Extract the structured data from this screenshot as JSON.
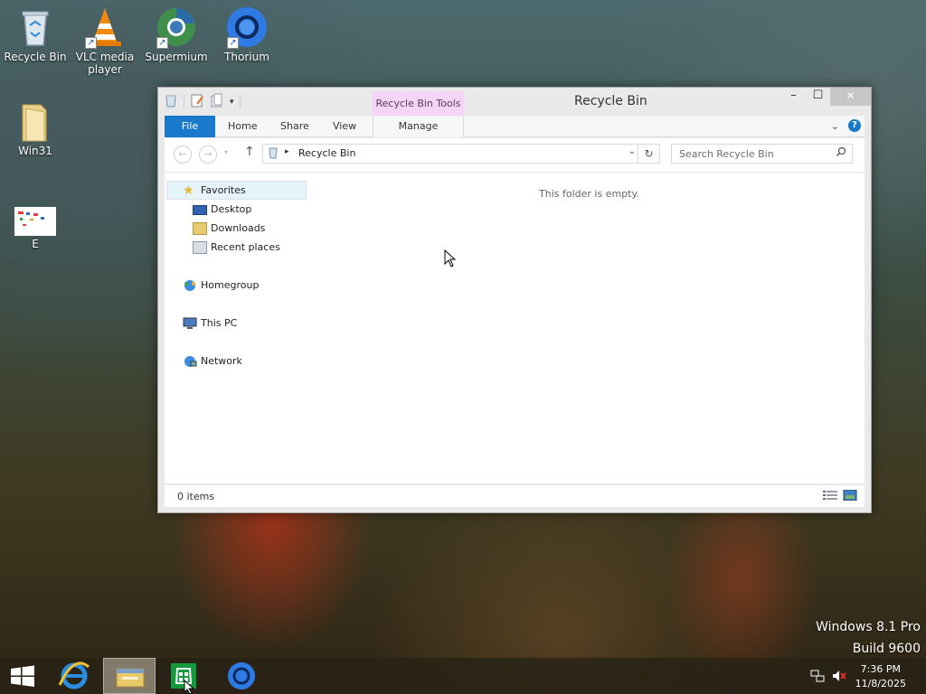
{
  "desktop": {
    "icons": [
      {
        "label": "Recycle Bin",
        "icon": "recycle-bin-icon"
      },
      {
        "label": "VLC media player",
        "icon": "vlc-icon"
      },
      {
        "label": "Supermium",
        "icon": "supermium-icon"
      },
      {
        "label": "Thorium",
        "icon": "thorium-icon"
      },
      {
        "label": "Win31",
        "icon": "folder-icon"
      },
      {
        "label": "E",
        "icon": "image-file-icon"
      }
    ]
  },
  "window": {
    "title": "Recycle Bin",
    "context_tab": "Recycle Bin Tools",
    "tabs": {
      "file": "File",
      "home": "Home",
      "share": "Share",
      "view": "View",
      "manage": "Manage"
    },
    "address": {
      "crumb": "Recycle Bin"
    },
    "search": {
      "placeholder": "Search Recycle Bin"
    },
    "nav_pane": {
      "favorites": "Favorites",
      "desktop": "Desktop",
      "downloads": "Downloads",
      "recent_places": "Recent places",
      "homegroup": "Homegroup",
      "this_pc": "This PC",
      "network": "Network"
    },
    "empty_message": "This folder is empty.",
    "status": {
      "item_count": "0 items"
    }
  },
  "watermark": {
    "line1": "Windows 8.1 Pro",
    "line2": "Build 9600"
  },
  "taskbar": {
    "clock": {
      "time": "7:36 PM",
      "date": "11/8/2025"
    }
  },
  "colors": {
    "accent": "#1979ca",
    "context_tab": "#f5d4f5"
  }
}
